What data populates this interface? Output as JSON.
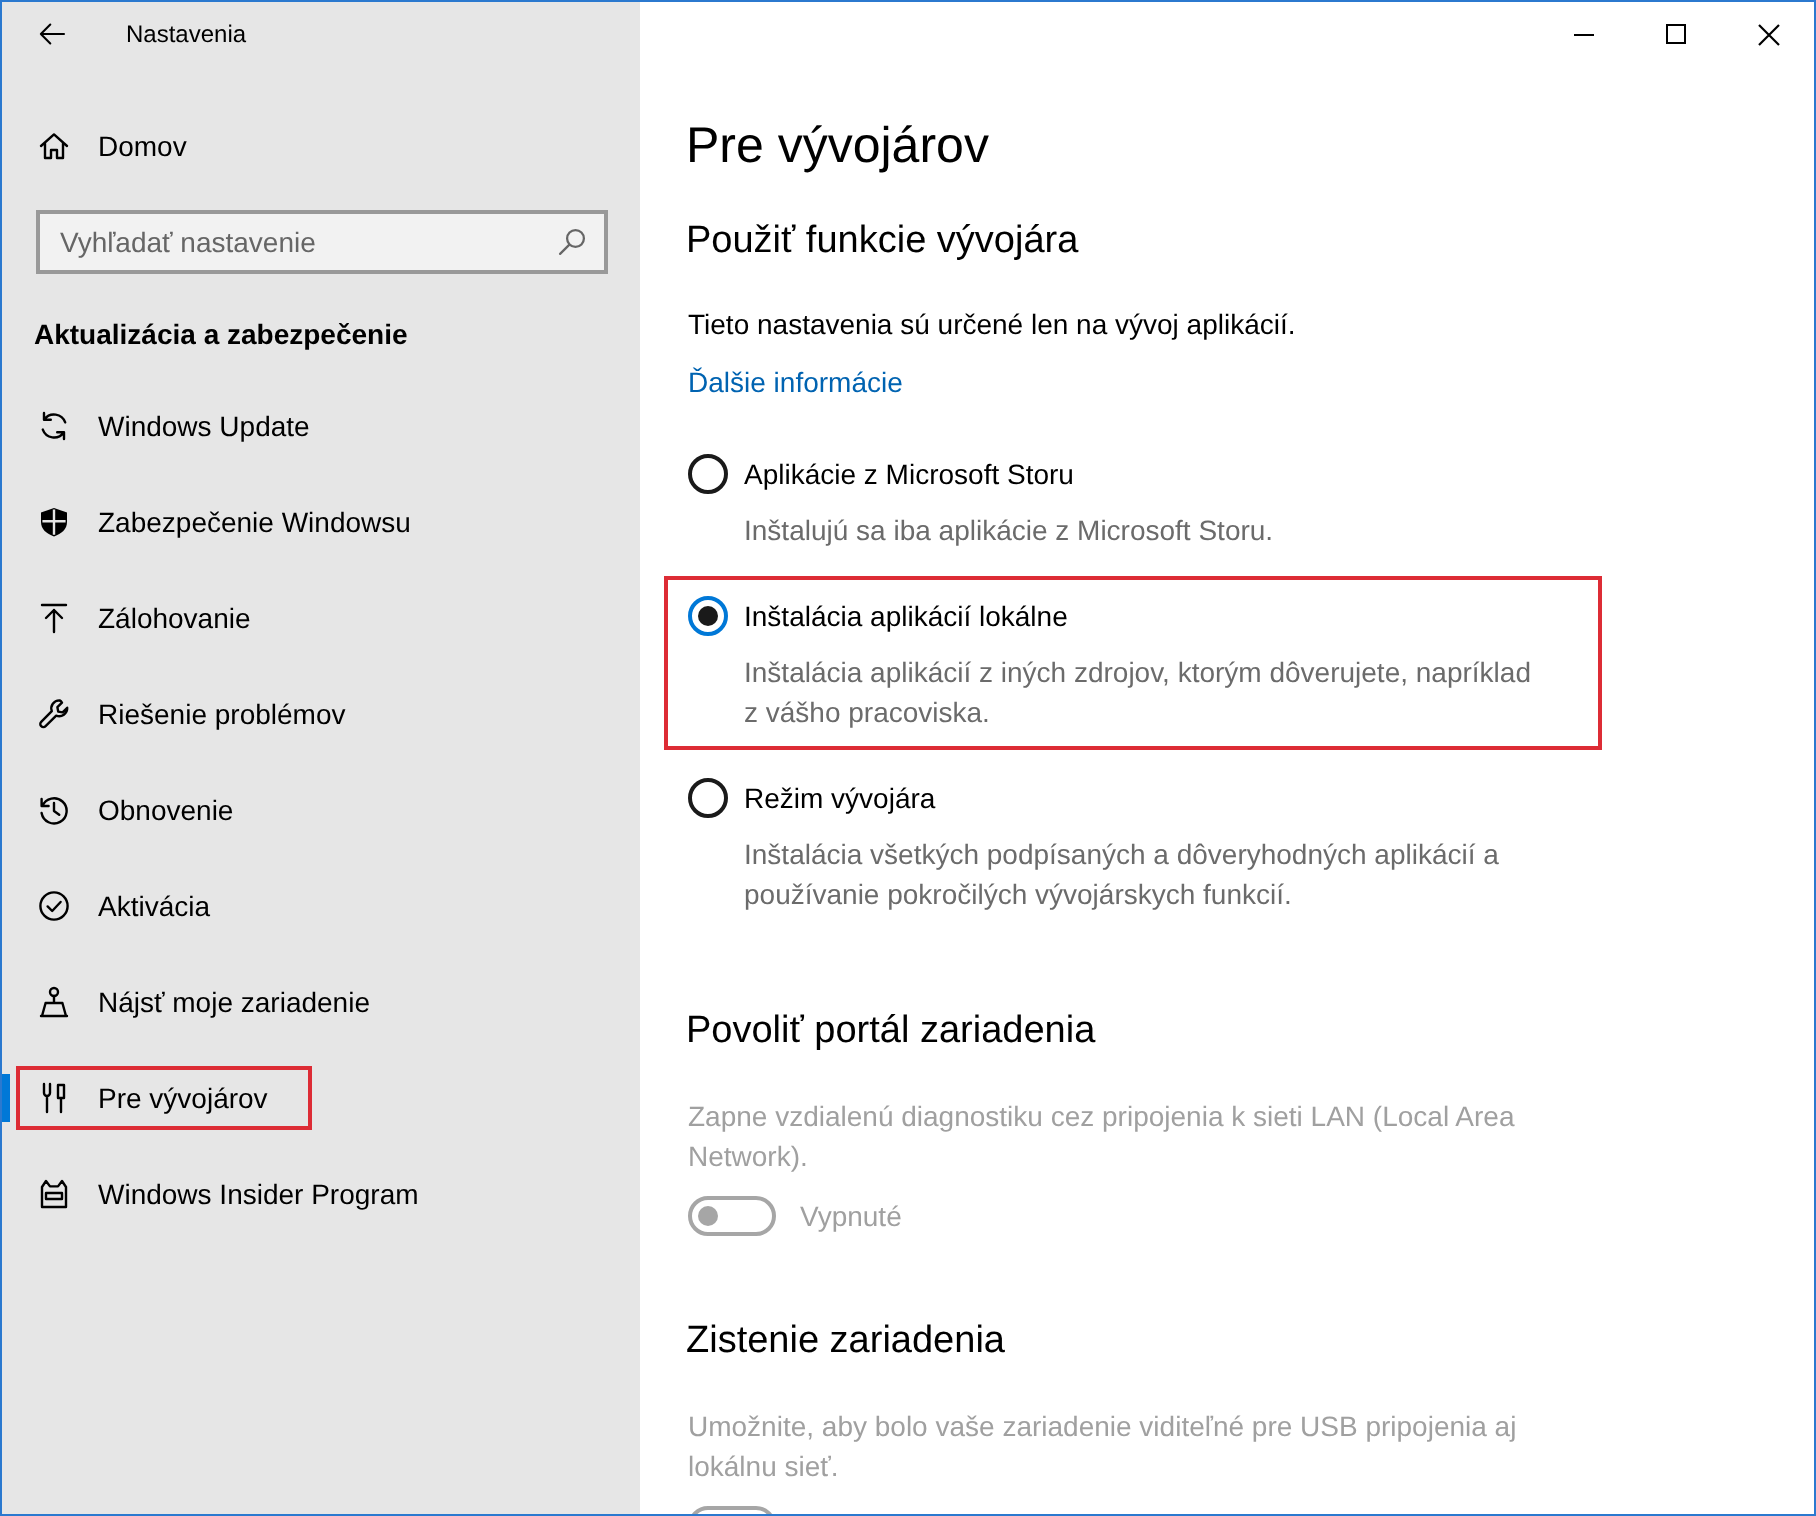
{
  "window": {
    "title": "Nastavenia"
  },
  "sidebar": {
    "home": {
      "label": "Domov"
    },
    "search": {
      "placeholder": "Vyhľadať nastavenie"
    },
    "section_title": "Aktualizácia a zabezpečenie",
    "items": [
      {
        "label": "Windows Update",
        "selected": false,
        "highlighted": false
      },
      {
        "label": "Zabezpečenie Windowsu",
        "selected": false,
        "highlighted": false
      },
      {
        "label": "Zálohovanie",
        "selected": false,
        "highlighted": false
      },
      {
        "label": "Riešenie problémov",
        "selected": false,
        "highlighted": false
      },
      {
        "label": "Obnovenie",
        "selected": false,
        "highlighted": false
      },
      {
        "label": "Aktivácia",
        "selected": false,
        "highlighted": false
      },
      {
        "label": "Nájsť moje zariadenie",
        "selected": false,
        "highlighted": false
      },
      {
        "label": "Pre vývojárov",
        "selected": true,
        "highlighted": true
      },
      {
        "label": "Windows Insider Program",
        "selected": false,
        "highlighted": false
      }
    ]
  },
  "page": {
    "title": "Pre vývojárov",
    "developer_features": {
      "heading": "Použiť funkcie vývojára",
      "intro": "Tieto nastavenia sú určené len na vývoj aplikácií.",
      "link": "Ďalšie informácie",
      "options": [
        {
          "label": "Aplikácie z Microsoft Storu",
          "description": "Inštalujú sa iba aplikácie z Microsoft Storu.",
          "selected": false,
          "highlighted": false
        },
        {
          "label": "Inštalácia aplikácií lokálne",
          "description": "Inštalácia aplikácií z iných zdrojov, ktorým dôverujete, napríklad z vášho pracoviska.",
          "selected": true,
          "highlighted": true
        },
        {
          "label": "Režim vývojára",
          "description": "Inštalácia všetkých podpísaných a dôveryhodných aplikácií a používanie pokročilých vývojárskych funkcií.",
          "selected": false,
          "highlighted": false
        }
      ]
    },
    "toggle_sections": [
      {
        "heading": "Povoliť portál zariadenia",
        "description": "Zapne vzdialenú diagnostiku cez pripojenia k sieti LAN (Local Area Network).",
        "disabled": true,
        "toggle": {
          "on": false,
          "state_label": "Vypnuté"
        }
      },
      {
        "heading": "Zistenie zariadenia",
        "description": "Umožnite, aby bolo vaše zariadenie viditeľné pre USB pripojenia aj lokálnu sieť.",
        "disabled": true,
        "toggle": {
          "on": false
        }
      }
    ]
  }
}
